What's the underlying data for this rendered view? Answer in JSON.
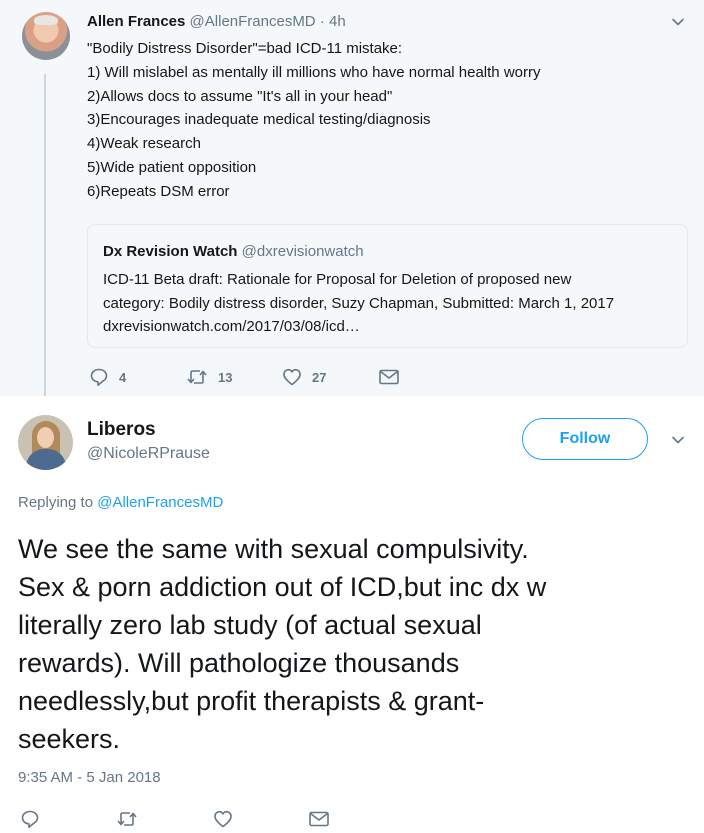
{
  "parent_tweet": {
    "author_name": "Allen Frances",
    "author_handle": "@AllenFrancesMD",
    "separator": " · ",
    "time_ago": "4h",
    "body_lines": [
      "\"Bodily Distress Disorder\"=bad ICD-11 mistake:",
      "1) Will mislabel as mentally ill millions who have normal health worry",
      "2)Allows docs to assume \"It's all in your head\"",
      "3)Encourages inadequate medical testing/diagnosis",
      "4)Weak research",
      "5)Wide patient opposition",
      "6)Repeats DSM error"
    ],
    "quoted": {
      "author_name": "Dx Revision Watch",
      "author_handle": "@dxrevisionwatch",
      "body_lines": [
        "ICD-11 Beta draft: Rationale for Proposal for Deletion of proposed new",
        "category: Bodily distress disorder, Suzy Chapman, Submitted: March 1, 2017",
        "dxrevisionwatch.com/2017/03/08/icd…"
      ]
    },
    "actions": {
      "replies": "4",
      "retweets": "13",
      "likes": "27"
    },
    "icons": [
      "reply-icon",
      "retweet-icon",
      "like-icon",
      "direct-message-icon",
      "chevron-down-icon"
    ]
  },
  "main_tweet": {
    "author_name": "Liberos",
    "author_handle": "@NicoleRPrause",
    "follow_label": "Follow",
    "replying_prefix": "Replying to ",
    "replying_to": "@AllenFrancesMD",
    "text_lines": [
      "We see the same with sexual compulsivity.",
      "Sex & porn addiction out of ICD,but inc dx w",
      "literally zero lab study (of actual sexual",
      "rewards). Will pathologize thousands",
      "needlessly,but profit therapists & grant-",
      "seekers."
    ],
    "timestamp": "9:35 AM - 5 Jan 2018"
  },
  "colors": {
    "accent": "#1da1f2",
    "secondary_text": "#657786",
    "primary_text": "#14171a",
    "parent_background": "#f5f8fa",
    "border": "#e1e8ed",
    "thread_line": "#ccd6dd"
  }
}
